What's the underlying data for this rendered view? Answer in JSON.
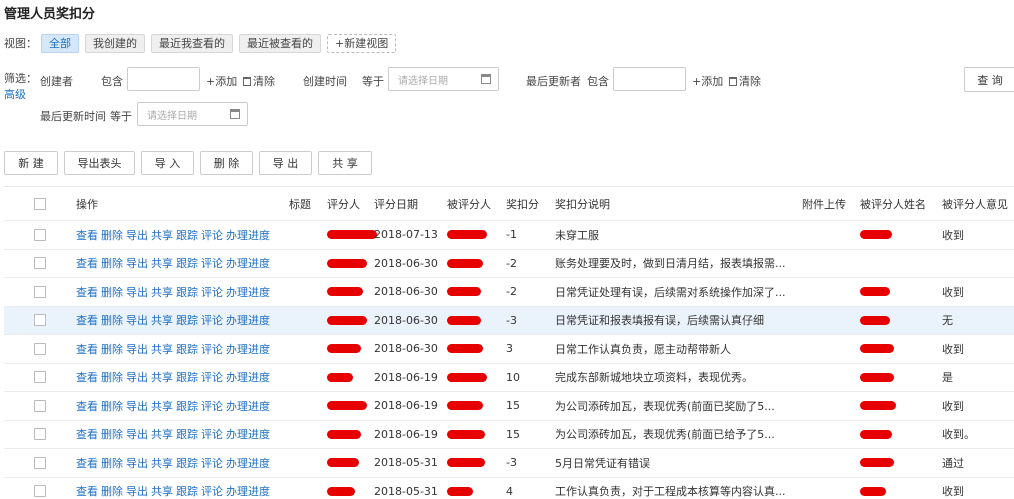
{
  "page": {
    "title": "管理人员奖扣分"
  },
  "views": {
    "label": "视图：",
    "tabs": [
      "全部",
      "我创建的",
      "最近我查看的",
      "最近被查看的"
    ],
    "new_view": "+新建视图"
  },
  "filter": {
    "label": "筛选：",
    "advanced": "高级",
    "creator": "创建者",
    "contains": "包含",
    "add": "+添加",
    "clear": "清除",
    "create_time": "创建时间",
    "equals": "等于",
    "date_placeholder": "请选择日期",
    "last_updater": "最后更新者",
    "last_update_time": "最后更新时间",
    "query": "查 询"
  },
  "toolbar": {
    "new": "新 建",
    "export_header": "导出表头",
    "import": "导 入",
    "delete": "删 除",
    "export": "导 出",
    "share": "共 享"
  },
  "table": {
    "columns": [
      "操作",
      "标题",
      "评分人",
      "评分日期",
      "被评分人",
      "奖扣分",
      "奖扣分说明",
      "附件上传",
      "被评分人姓名",
      "被评分人意见"
    ],
    "actions": [
      "查看",
      "删除",
      "导出",
      "共享",
      "跟踪",
      "评论",
      "办理进度"
    ],
    "rows": [
      {
        "date": "2018-07-13",
        "points": "-1",
        "desc": "未穿工服",
        "opinion": "收到"
      },
      {
        "date": "2018-06-30",
        "points": "-2",
        "desc": "账务处理要及时，做到日清月结，报表填报需...",
        "opinion": ""
      },
      {
        "date": "2018-06-30",
        "points": "-2",
        "desc": "日常凭证处理有误，后续需对系统操作加深了...",
        "opinion": "收到"
      },
      {
        "date": "2018-06-30",
        "points": "-3",
        "desc": "日常凭证和报表填报有误，后续需认真仔细",
        "opinion": "无"
      },
      {
        "date": "2018-06-30",
        "points": "3",
        "desc": "日常工作认真负责，愿主动帮带新人",
        "opinion": "收到"
      },
      {
        "date": "2018-06-19",
        "points": "10",
        "desc": "完成东部新城地块立项资料，表现优秀。",
        "opinion": "是"
      },
      {
        "date": "2018-06-19",
        "points": "15",
        "desc": "为公司添砖加瓦，表现优秀(前面已奖励了5...",
        "opinion": "收到"
      },
      {
        "date": "2018-06-19",
        "points": "15",
        "desc": "为公司添砖加瓦，表现优秀(前面已给予了5...",
        "opinion": "收到。"
      },
      {
        "date": "2018-05-31",
        "points": "-3",
        "desc": "5月日常凭证有错误",
        "opinion": "通过"
      },
      {
        "date": "2018-05-31",
        "points": "4",
        "desc": "工作认真负责，对于工程成本核算等内容认真...",
        "opinion": "收到"
      }
    ]
  }
}
